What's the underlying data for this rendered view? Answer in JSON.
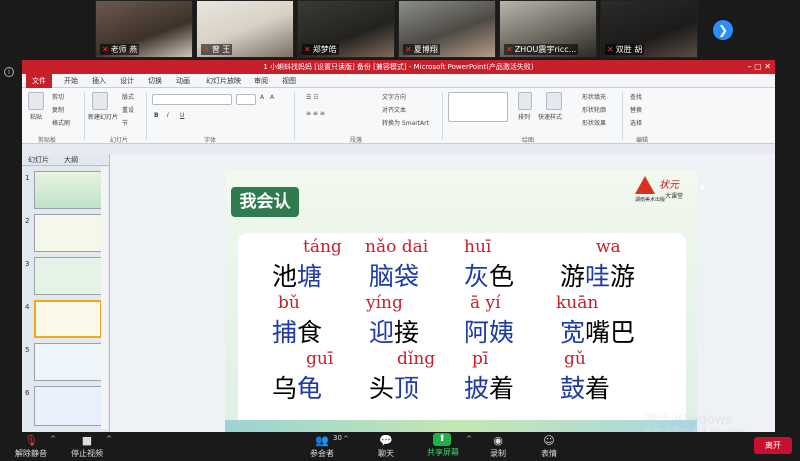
{
  "participants": [
    {
      "name": "老师 燕"
    },
    {
      "name": "曾 王"
    },
    {
      "name": "郑梦皓"
    },
    {
      "name": "夏博翔"
    },
    {
      "name": "ZHOU震宇ricc..."
    },
    {
      "name": "双胜 胡"
    }
  ],
  "ppt": {
    "title": "1 小蝌蚪找妈妈 [设置只读版] 备份 [兼容模式] - Microsoft PowerPoint(产品激活失败)",
    "tabs": [
      "文件",
      "开始",
      "插入",
      "设计",
      "切换",
      "动画",
      "幻灯片放映",
      "审阅",
      "视图"
    ],
    "ribbon": {
      "clipboard": {
        "paste": "粘贴",
        "cut": "剪切",
        "copy": "复制",
        "format_painter": "格式刷",
        "group": "剪贴板"
      },
      "slides": {
        "new_slide": "新建幻灯片",
        "layout": "版式",
        "reset": "重设",
        "section": "节",
        "group": "幻灯片"
      },
      "font_group": "字体",
      "paragraph": {
        "text_direction": "文字方向",
        "align_text": "对齐文本",
        "smartart": "转换为 SmartArt",
        "group": "段落"
      },
      "drawing": {
        "arrange": "排列",
        "quick_styles": "快速样式",
        "fill": "形状填充",
        "outline": "形状轮廓",
        "effects": "形状效果",
        "group": "绘图"
      },
      "editing": {
        "find": "查找",
        "replace": "替换",
        "select": "选择",
        "group": "编辑"
      }
    },
    "pane_tabs": [
      "幻灯片",
      "大纲"
    ],
    "thumbs": [
      "1",
      "2",
      "3",
      "4",
      "5",
      "6"
    ],
    "slide": {
      "badge": "我会认",
      "logo": {
        "brand": "状元",
        "sub": "大课堂",
        "publisher": "湖南美术出版"
      },
      "rows": [
        [
          {
            "py": "táng",
            "prefix": "池",
            "hi": "塘",
            "suffix": ""
          },
          {
            "py": "nǎo dai",
            "prefix": "",
            "hi": "脑袋",
            "suffix": ""
          },
          {
            "py": "huī",
            "prefix": "",
            "hi": "灰",
            "suffix": "色"
          },
          {
            "py": "wa",
            "prefix": "游",
            "hi": "哇",
            "suffix": "游"
          }
        ],
        [
          {
            "py": "bǔ",
            "prefix": "",
            "hi": "捕",
            "suffix": "食"
          },
          {
            "py": "yíng",
            "prefix": "",
            "hi": "迎",
            "suffix": "接"
          },
          {
            "py": "ā yí",
            "prefix": "",
            "hi": "阿姨",
            "suffix": ""
          },
          {
            "py": "kuān",
            "prefix": "",
            "hi": "宽",
            "suffix": "嘴巴"
          }
        ],
        [
          {
            "py": "guī",
            "prefix": "乌",
            "hi": "龟",
            "suffix": ""
          },
          {
            "py": "dǐng",
            "prefix": "头",
            "hi": "顶",
            "suffix": ""
          },
          {
            "py": "pī",
            "prefix": "",
            "hi": "披",
            "suffix": "着"
          },
          {
            "py": "gǔ",
            "prefix": "",
            "hi": "鼓",
            "suffix": "着"
          }
        ]
      ]
    }
  },
  "toolbar": {
    "mute": "解除静音",
    "video": "停止视频",
    "participants": "参会者",
    "participants_count": "30",
    "chat": "聊天",
    "share": "共享屏幕",
    "record": "录制",
    "reactions": "表情",
    "leave": "离开"
  },
  "watermark": {
    "line1": "激活 Windows",
    "line2": "转到\"设置\"以激活 Windows。"
  }
}
